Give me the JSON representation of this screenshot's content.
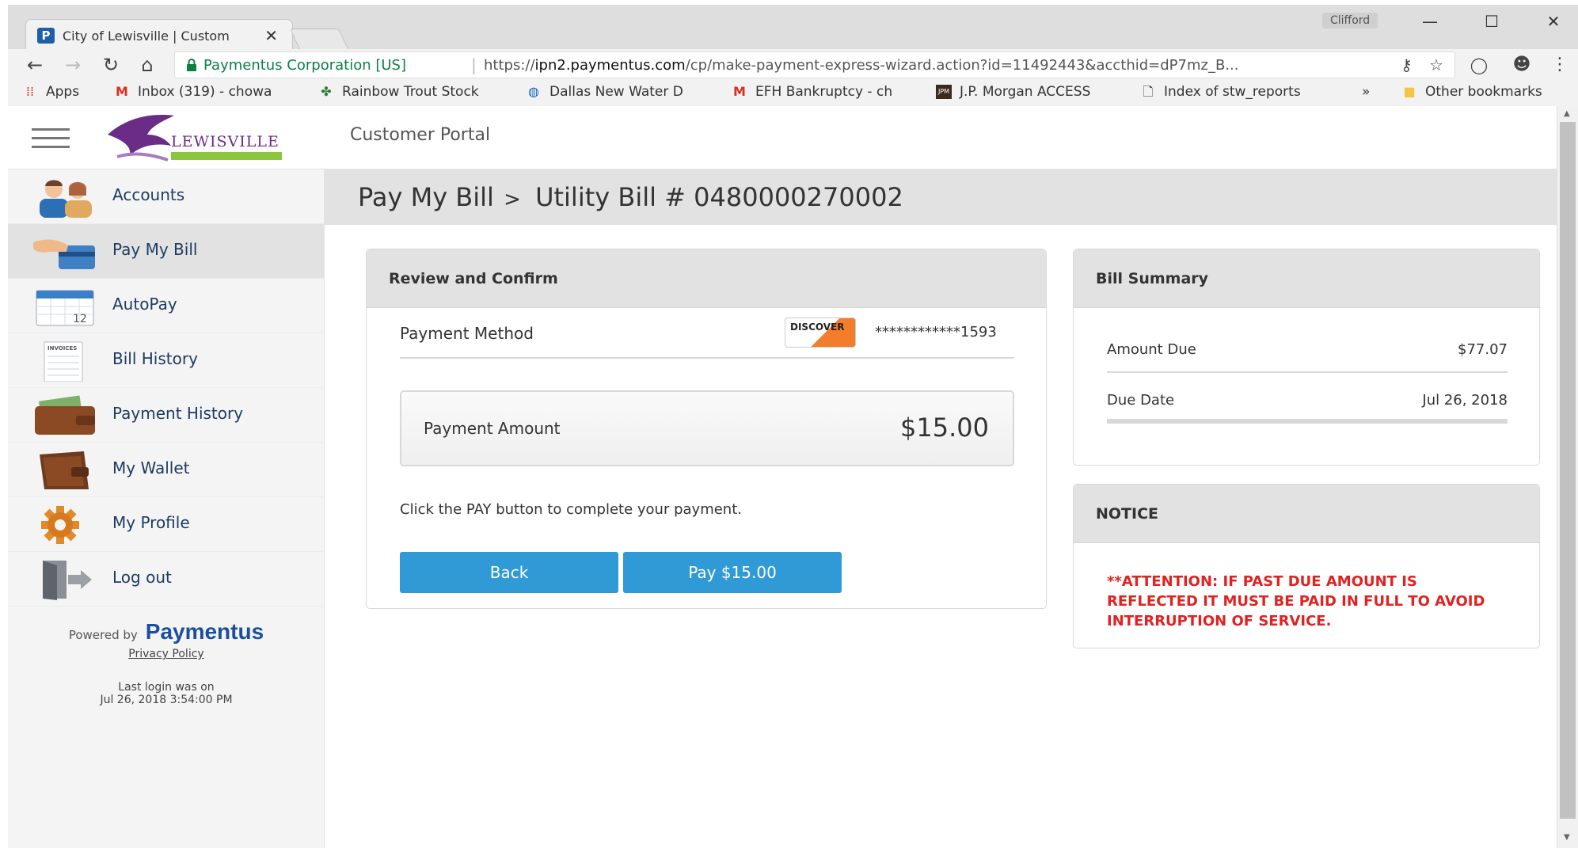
{
  "browser": {
    "tab_title": "City of Lewisville | Custom",
    "tab_favicon": "P",
    "tab_close": "✕",
    "profile": "Clifford",
    "window_controls": {
      "minimize": "—",
      "maximize": "☐",
      "close": "✕"
    },
    "nav": {
      "back": "←",
      "forward": "→",
      "reload": "↻",
      "home": "⌂"
    },
    "secure_label": "Paymentus Corporation [US]",
    "url_prefix": "https://",
    "url_host": "ipn2.paymentus.com",
    "url_path": "/cp/make-payment-express-wizard.action?id=11492443&accthid=dP7mz_B...",
    "bookmarks": [
      {
        "icon": "apps-grid-icon",
        "label": "Apps"
      },
      {
        "icon": "gmail-icon",
        "label": "Inbox (319) - chowa"
      },
      {
        "icon": "leaf-icon",
        "label": "Rainbow Trout Stock"
      },
      {
        "icon": "globe-icon",
        "label": "Dallas New Water D"
      },
      {
        "icon": "gmail-icon",
        "label": "EFH Bankruptcy - ch"
      },
      {
        "icon": "jpm-icon",
        "label": "J.P. Morgan ACCESS"
      },
      {
        "icon": "page-icon",
        "label": "Index of stw_reports"
      }
    ],
    "bookmarks_overflow": "»",
    "other_bookmarks": "Other bookmarks"
  },
  "header": {
    "logo_text": "LEWISVILLE",
    "portal_title": "Customer Portal"
  },
  "sidebar": {
    "items": [
      {
        "label": "Accounts",
        "icon": "people-icon",
        "active": false
      },
      {
        "label": "Pay My Bill",
        "icon": "hand-card-icon",
        "active": true
      },
      {
        "label": "AutoPay",
        "icon": "calendar-icon",
        "calendar_day": "12",
        "active": false
      },
      {
        "label": "Bill History",
        "icon": "invoice-icon",
        "invoice_text": "INVOICES",
        "active": false
      },
      {
        "label": "Payment History",
        "icon": "cash-wallet-icon",
        "active": false
      },
      {
        "label": "My Wallet",
        "icon": "wallet-icon",
        "active": false
      },
      {
        "label": "My Profile",
        "icon": "gear-icon",
        "active": false
      },
      {
        "label": "Log out",
        "icon": "logout-door-icon",
        "active": false
      }
    ],
    "powered_by": "Powered by",
    "brand": "Paymentus",
    "privacy": "Privacy Policy",
    "last_login_1": "Last login was on",
    "last_login_2": "Jul 26, 2018 3:54:00 PM"
  },
  "breadcrumb": {
    "parent": "Pay My Bill",
    "separator": ">",
    "current": "Utility Bill # 0480000270002"
  },
  "review": {
    "heading": "Review and Confirm",
    "payment_method_label": "Payment Method",
    "card_brand": "DISCOVER",
    "card_number": "************1593",
    "payment_amount_label": "Payment Amount",
    "payment_amount": "$15.00",
    "instruction": "Click the PAY button to complete your payment.",
    "back_button": "Back",
    "pay_button": "Pay $15.00"
  },
  "bill_summary": {
    "heading": "Bill Summary",
    "rows": [
      {
        "label": "Amount Due",
        "value": "$77.07"
      },
      {
        "label": "Due Date",
        "value": "Jul 26, 2018"
      }
    ]
  },
  "notice": {
    "heading": "NOTICE",
    "text": "**ATTENTION: IF PAST DUE AMOUNT IS REFLECTED IT MUST BE PAID IN FULL TO AVOID INTERRUPTION OF SERVICE."
  },
  "colors": {
    "accent_button": "#2f9ad6",
    "nav_text": "#1d3b63",
    "notice_red": "#e02222",
    "secure_green": "#0b8043",
    "brand_purple": "#6b2c87"
  }
}
